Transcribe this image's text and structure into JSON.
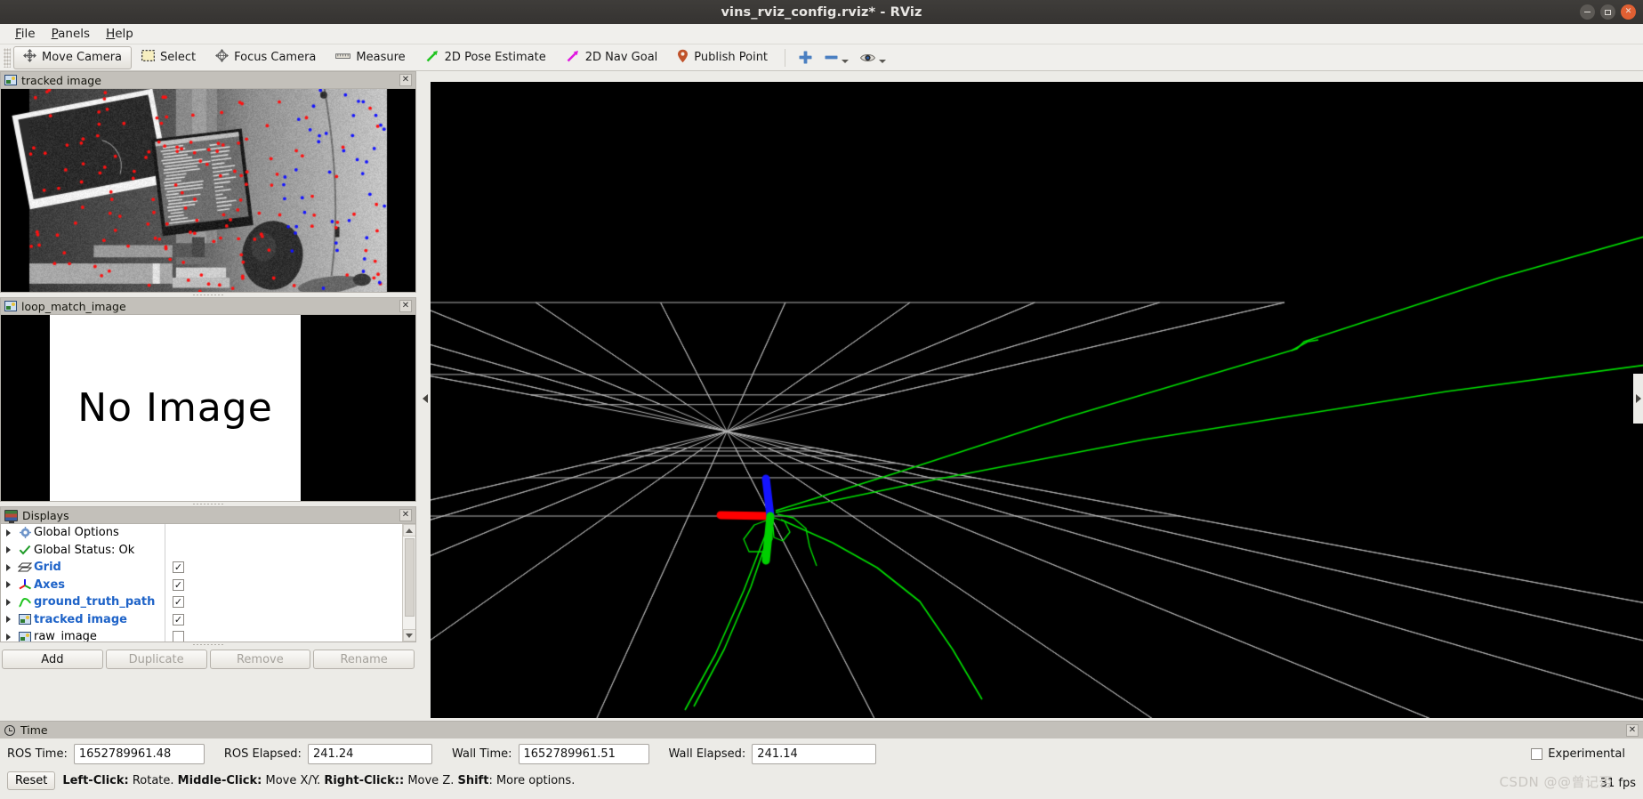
{
  "window": {
    "title": "vins_rviz_config.rviz* - RViz",
    "controls": {
      "minimize": "–",
      "maximize": "□",
      "close": "✕"
    }
  },
  "menubar": {
    "items": [
      {
        "label": "File",
        "mnemonic": "F"
      },
      {
        "label": "Panels",
        "mnemonic": "P"
      },
      {
        "label": "Help",
        "mnemonic": "H"
      }
    ]
  },
  "toolbar": {
    "tools": [
      {
        "label": "Move Camera",
        "icon": "move-camera-icon",
        "active": true
      },
      {
        "label": "Select",
        "icon": "select-icon",
        "active": false
      },
      {
        "label": "Focus Camera",
        "icon": "focus-camera-icon",
        "active": false
      },
      {
        "label": "Measure",
        "icon": "measure-icon",
        "active": false
      },
      {
        "label": "2D Pose Estimate",
        "icon": "pose-estimate-icon",
        "active": false
      },
      {
        "label": "2D Nav Goal",
        "icon": "nav-goal-icon",
        "active": false
      },
      {
        "label": "Publish Point",
        "icon": "publish-point-icon",
        "active": false
      }
    ],
    "extra_icons": [
      {
        "name": "add-view-icon",
        "glyph": "+"
      },
      {
        "name": "remove-view-icon",
        "glyph": "–"
      },
      {
        "name": "visibility-eye-icon",
        "glyph": "eye"
      }
    ]
  },
  "panels": {
    "tracked_image": {
      "title": "tracked image",
      "icon": "image-display-icon",
      "close": "✕"
    },
    "loop_match_image": {
      "title": "loop_match_image",
      "icon": "image-display-icon",
      "close": "✕",
      "content_text": "No Image"
    },
    "displays": {
      "title": "Displays",
      "icon": "displays-icon",
      "close": "✕",
      "tree": [
        {
          "label": "Global Options",
          "icon": "gear-icon",
          "highlight": false,
          "checkbox": null
        },
        {
          "label": "Global Status: Ok",
          "icon": "check-icon",
          "highlight": false,
          "checkbox": null
        },
        {
          "label": "Grid",
          "icon": "grid-icon",
          "highlight": true,
          "checkbox": true
        },
        {
          "label": "Axes",
          "icon": "axes-icon",
          "highlight": true,
          "checkbox": true
        },
        {
          "label": "ground_truth_path",
          "icon": "path-icon",
          "highlight": true,
          "checkbox": true
        },
        {
          "label": "tracked image",
          "icon": "image-display-icon",
          "highlight": true,
          "checkbox": true
        },
        {
          "label": "raw_image",
          "icon": "image-display-icon",
          "highlight": false,
          "checkbox": false
        }
      ],
      "buttons": [
        {
          "label": "Add",
          "enabled": true
        },
        {
          "label": "Duplicate",
          "enabled": false
        },
        {
          "label": "Remove",
          "enabled": false
        },
        {
          "label": "Rename",
          "enabled": false
        }
      ]
    },
    "time": {
      "title": "Time",
      "icon": "clock-icon",
      "close": "✕",
      "fields": [
        {
          "label": "ROS Time:",
          "value": "1652789961.48"
        },
        {
          "label": "ROS Elapsed:",
          "value": "241.24"
        },
        {
          "label": "Wall Time:",
          "value": "1652789961.51"
        },
        {
          "label": "Wall Elapsed:",
          "value": "241.14"
        }
      ],
      "experimental": {
        "label": "Experimental",
        "checked": false
      },
      "reset_button": "Reset",
      "hint_parts": [
        {
          "text": "Left-Click:",
          "bold": true
        },
        {
          "text": " Rotate. ",
          "bold": false
        },
        {
          "text": "Middle-Click:",
          "bold": true
        },
        {
          "text": " Move X/Y. ",
          "bold": false
        },
        {
          "text": "Right-Click::",
          "bold": true
        },
        {
          "text": " Move Z. ",
          "bold": false
        },
        {
          "text": "Shift",
          "bold": true
        },
        {
          "text": ": More options.",
          "bold": false
        }
      ],
      "fps": "31 fps"
    }
  },
  "watermark": "CSDN @@曾记否",
  "view3d": {
    "background": "#000000",
    "grid_color": "#b4b4b4",
    "path_color": "#00e000",
    "axes": {
      "x": "#ff0000",
      "y": "#00d000",
      "z": "#1414ff"
    }
  },
  "colors": {
    "titlebar": "#3b3936",
    "chrome": "#ecebe7",
    "panel_header": "#c3c0ba",
    "link_blue": "#1e63c8",
    "accent_green": "#00e000"
  }
}
